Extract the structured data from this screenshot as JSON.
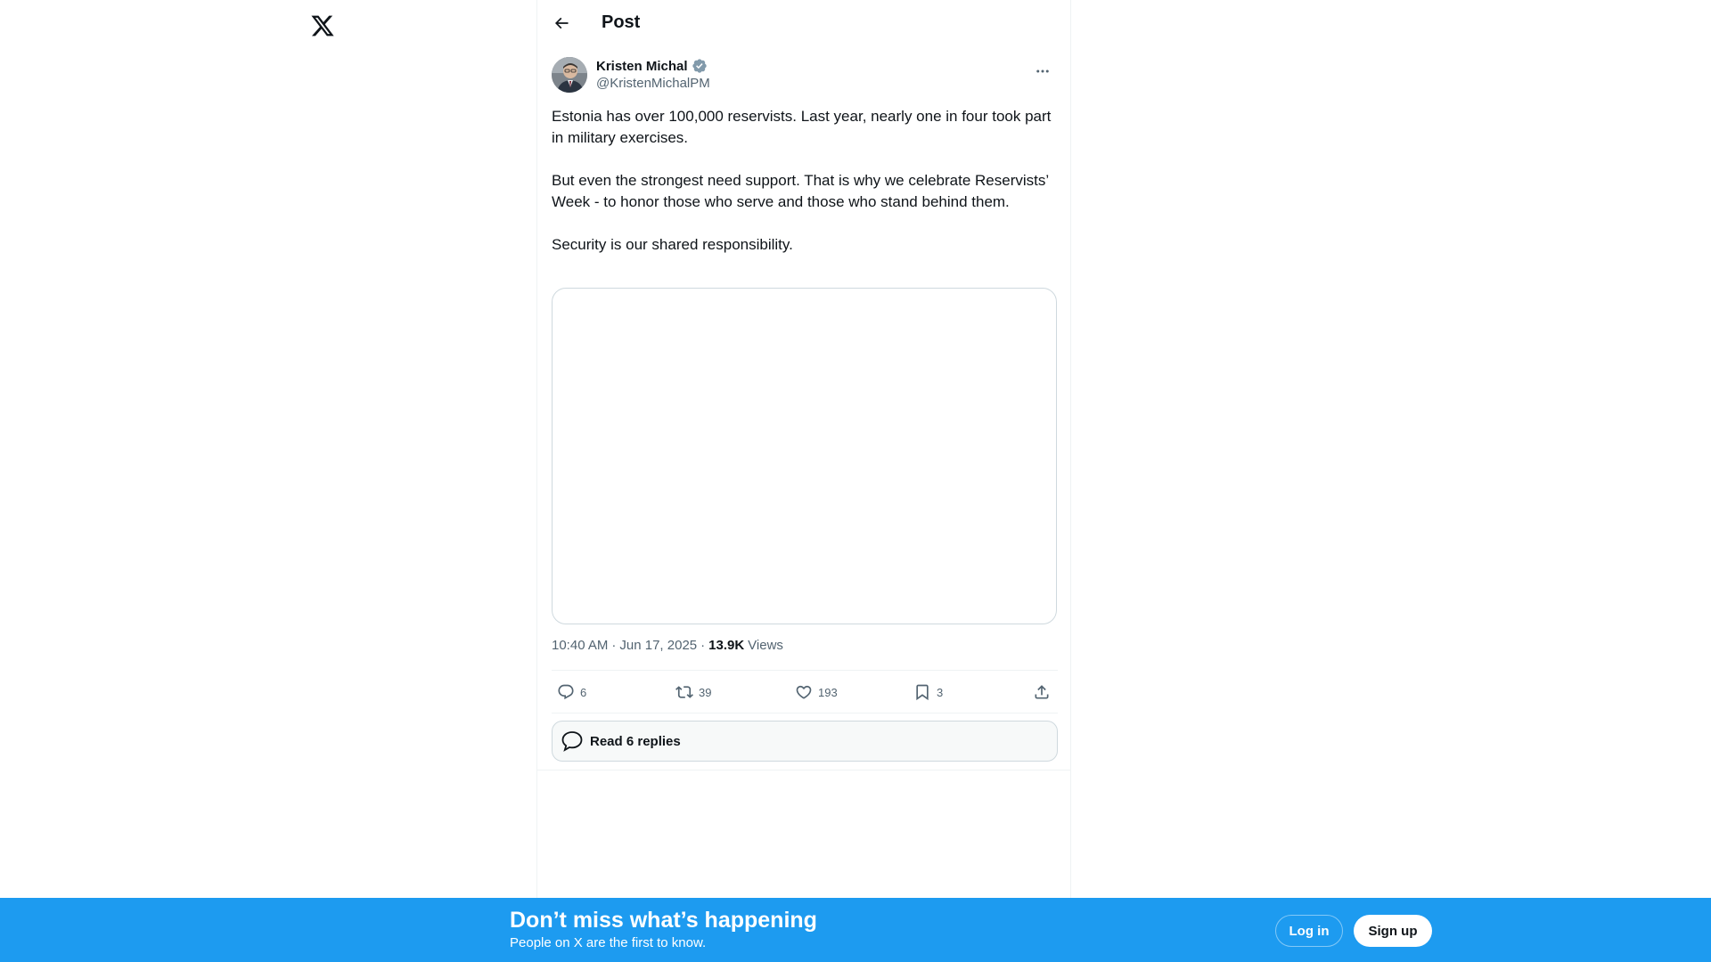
{
  "app": {
    "logo_icon": "x-logo-icon"
  },
  "header": {
    "back_icon": "arrow-left-icon",
    "title": "Post"
  },
  "post": {
    "author": {
      "name": "Kristen Michal",
      "handle": "@KristenMichalPM",
      "verified_icon": "verified-badge-icon",
      "avatar_icon": "avatar"
    },
    "more_icon": "more-horizontal-icon",
    "text": [
      "Estonia has over 100,000 reservists. Last year, nearly one in four took part in military exercises.",
      "But even the strongest need support. That is why we celebrate Reservists’ Week - to honor those who serve and those who stand behind them.",
      "Security is our shared responsibility."
    ],
    "meta": {
      "time": "10:40 AM",
      "separator": "·",
      "date": "Jun 17, 2025",
      "views_count": "13.9K",
      "views_label": "Views"
    },
    "actions": {
      "replies": "6",
      "reposts": "39",
      "likes": "193",
      "bookmarks": "3"
    },
    "read_replies_label": "Read 6 replies"
  },
  "banner": {
    "title": "Don’t miss what’s happening",
    "subtitle": "People on X are the first to know.",
    "login_label": "Log in",
    "signup_label": "Sign up"
  },
  "colors": {
    "accent": "#1d9bf0",
    "text_primary": "#0f1419",
    "text_secondary": "#536471",
    "border": "#cfd9de"
  }
}
